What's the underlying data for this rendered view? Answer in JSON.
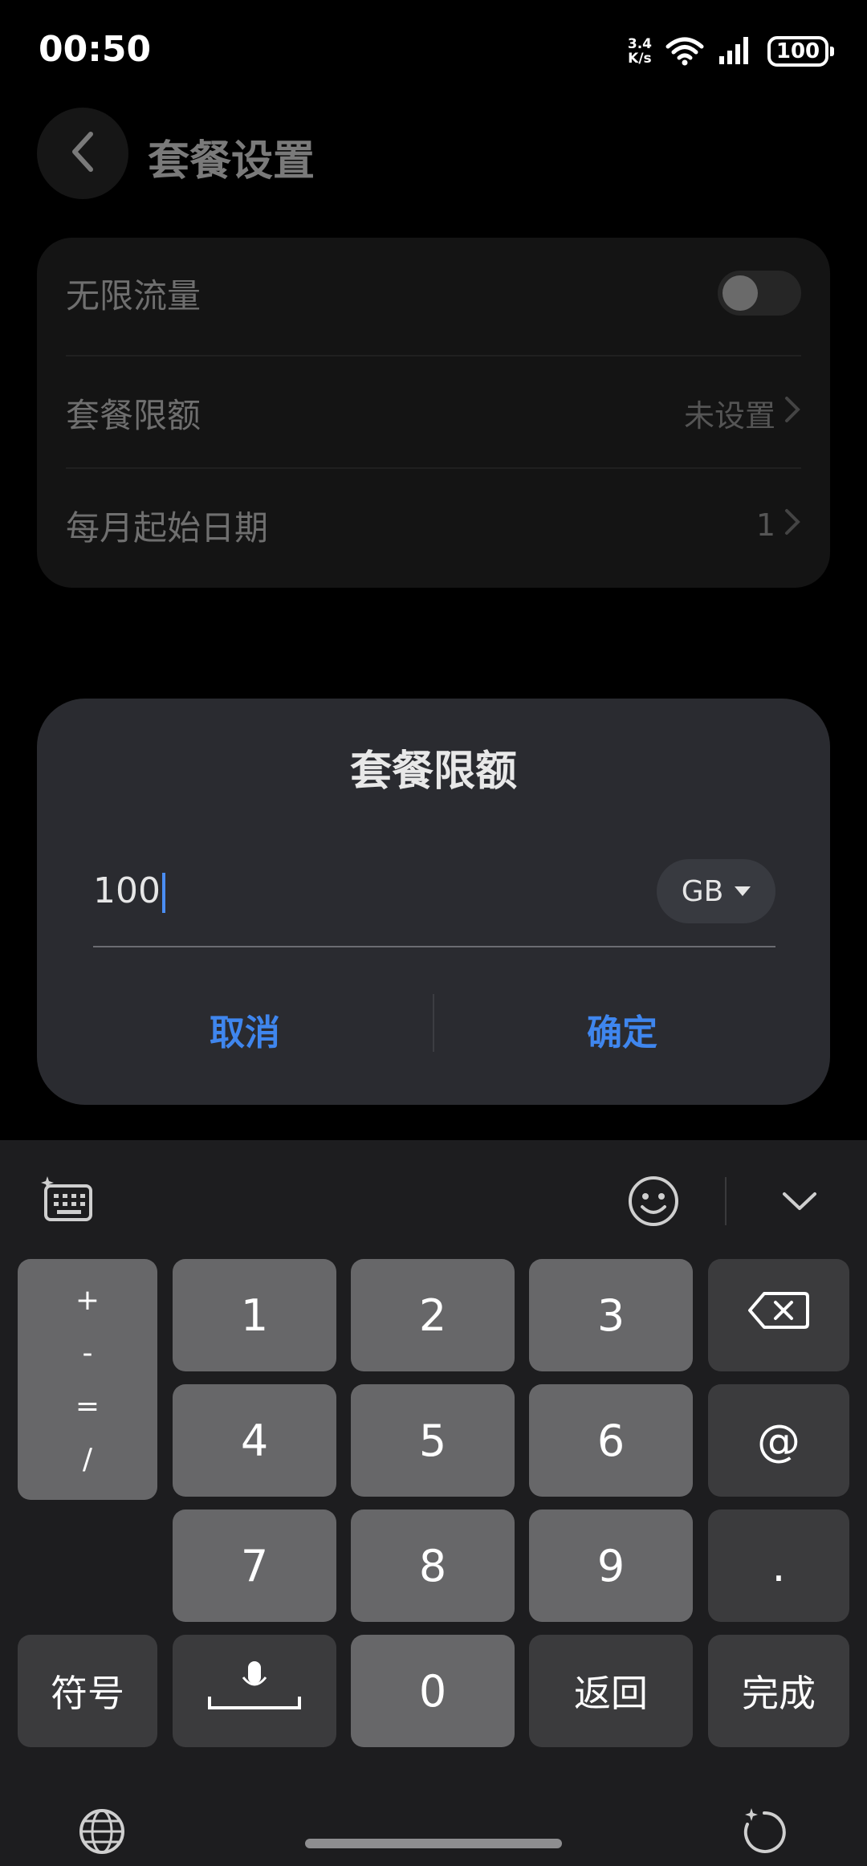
{
  "status_bar": {
    "time": "00:50",
    "net_speed_value": "3.4",
    "net_speed_unit": "K/s",
    "battery": "100"
  },
  "header": {
    "title": "套餐设置"
  },
  "settings": {
    "unlimited_data_label": "无限流量",
    "unlimited_data_on": false,
    "plan_limit_label": "套餐限额",
    "plan_limit_value": "未设置",
    "start_date_label": "每月起始日期",
    "start_date_value": "1"
  },
  "dialog": {
    "title": "套餐限额",
    "input_value": "100",
    "unit": "GB",
    "cancel_label": "取消",
    "confirm_label": "确定"
  },
  "keyboard": {
    "symbols_column": [
      "+",
      "-",
      "=",
      "/"
    ],
    "digits_row1": [
      "1",
      "2",
      "3"
    ],
    "digits_row2": [
      "4",
      "5",
      "6"
    ],
    "digits_row3": [
      "7",
      "8",
      "9"
    ],
    "at_key": "@",
    "dot_key": ".",
    "symbols_key": "符号",
    "zero_key": "0",
    "return_key": "返回",
    "done_key": "完成"
  },
  "colors": {
    "accent": "#3f86ee",
    "dialog_bg": "#2a2b30",
    "keyboard_bg": "#1d1d1f",
    "key_light": "#676769",
    "key_dark": "#3b3b3d"
  }
}
